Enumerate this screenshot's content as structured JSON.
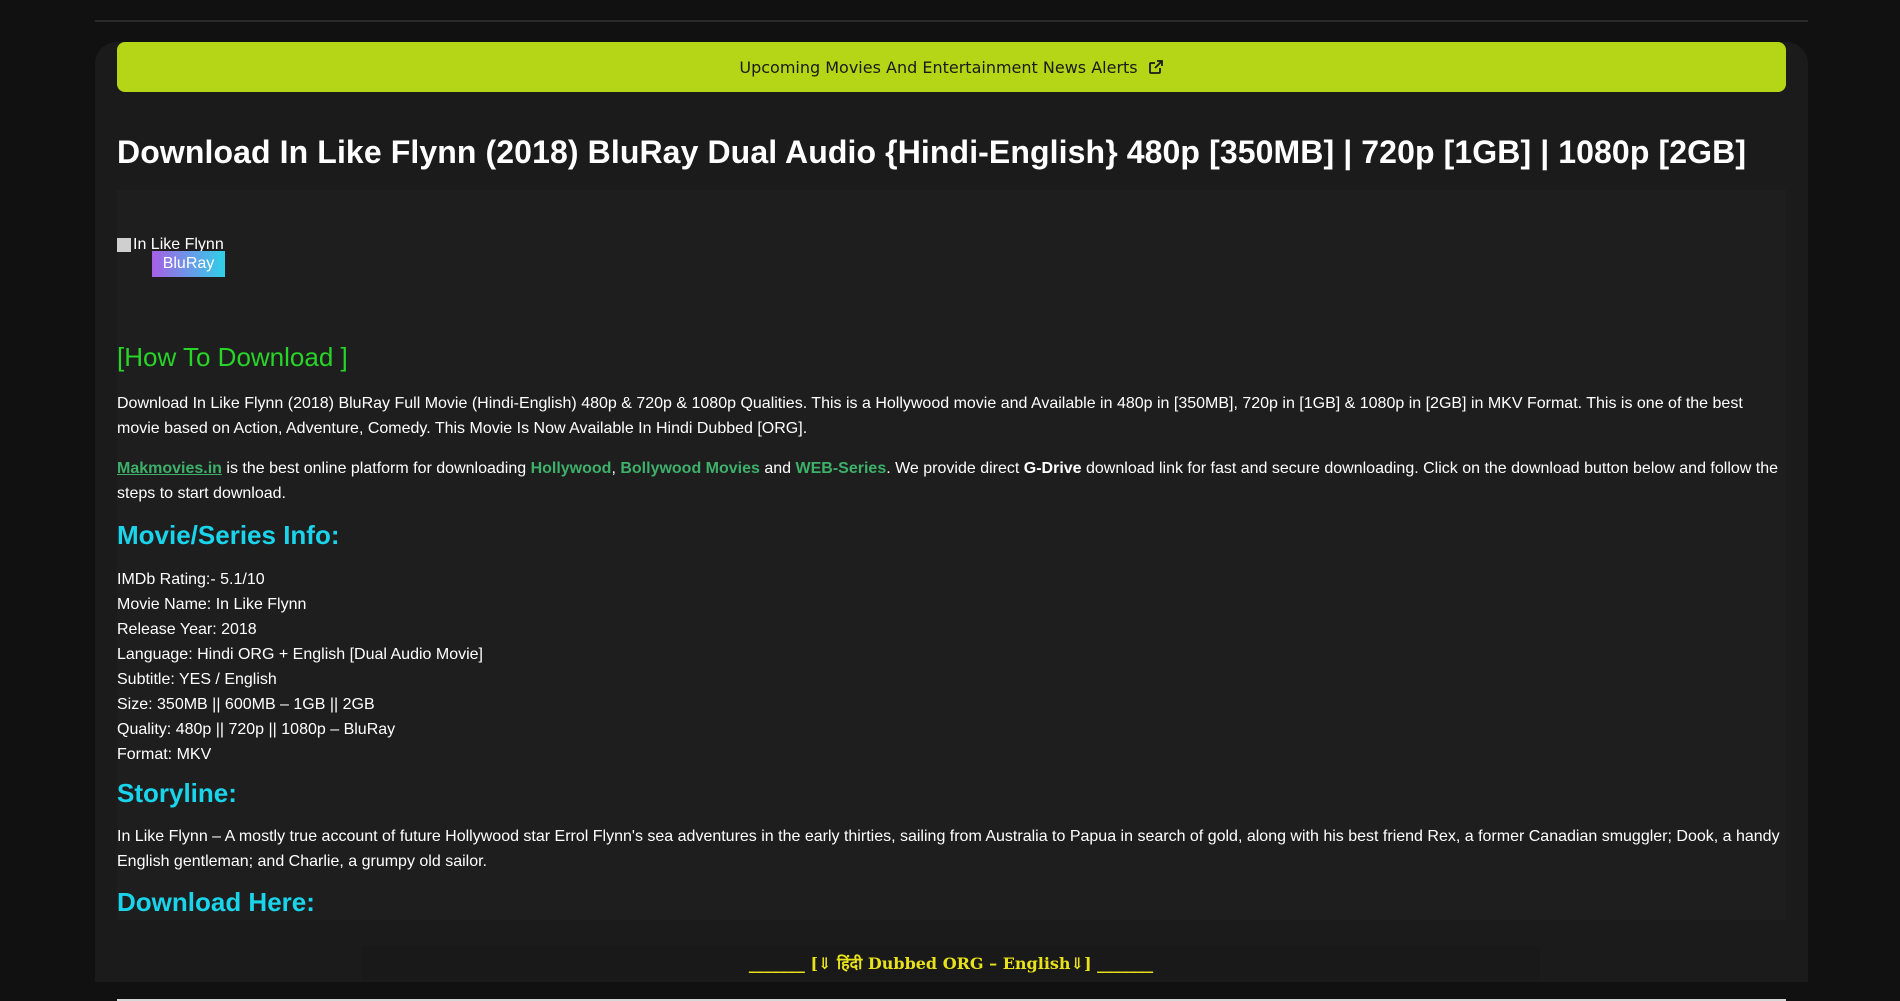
{
  "alert_bar": {
    "label": "Upcoming Movies And Entertainment News Alerts",
    "icon": "external-link-icon",
    "color": "#b5d616"
  },
  "title": "Download In Like Flynn (2018) BluRay Dual Audio {Hindi-English} 480p [350MB] | 720p [1GB] | 1080p [2GB]",
  "poster": {
    "alt": "In Like Flynn",
    "badge": "BluRay"
  },
  "how_to_download": "[How To Download ]",
  "description": "Download In Like Flynn (2018) BluRay Full Movie (Hindi-English) 480p & 720p & 1080p Qualities. This is a Hollywood movie and Available in 480p in [350MB], 720p in [1GB] & 1080p in [2GB] in MKV Format. This is one of the best movie based on Action, Adventure, Comedy. This Movie Is Now Available In Hindi Dubbed [ORG].",
  "platform": {
    "site_link": "Makmovies.in",
    "text1": " is the best online platform for downloading ",
    "hollywood_link": "Hollywood",
    "comma": ", ",
    "bollywood_link": "Bollywood Movies",
    "and": " and ",
    "webseries_link": "WEB-Series",
    "text2": ". We provide direct ",
    "gdrive": "G-Drive",
    "text3": " download link for fast and secure downloading. Click on the download button below and follow the steps to start download."
  },
  "info_heading": "Movie/Series Info:",
  "info": [
    "IMDb Rating:- 5.1/10",
    "Movie Name: In Like Flynn",
    "Release Year: 2018",
    "Language: Hindi ORG + English [Dual Audio Movie]",
    "Subtitle: YES / English",
    "Size: 350MB || 600MB – 1GB || 2GB",
    "Quality: 480p || 720p || 1080p – BluRay",
    "Format: MKV"
  ],
  "storyline_heading": "Storyline:",
  "storyline": "In Like Flynn – A mostly true account of future Hollywood star Errol Flynn's sea adventures in the early thirties, sailing from Australia to Papua in search of gold, along with his best friend Rex, a former Canadian smuggler; Dook, a handy English gentleman; and Charlie, a grumpy old sailor.",
  "download_heading": "Download Here:",
  "download_section_label": "_______ [⇓ हिंदी Dubbed ORG – English⇓] _______",
  "colors": {
    "background": "#111111",
    "panel": "#1b1b1b",
    "heading_cyan": "#19d4ea",
    "link_green": "#3db06a",
    "howto_green": "#27d427",
    "download_yellow": "#e8e21a"
  }
}
